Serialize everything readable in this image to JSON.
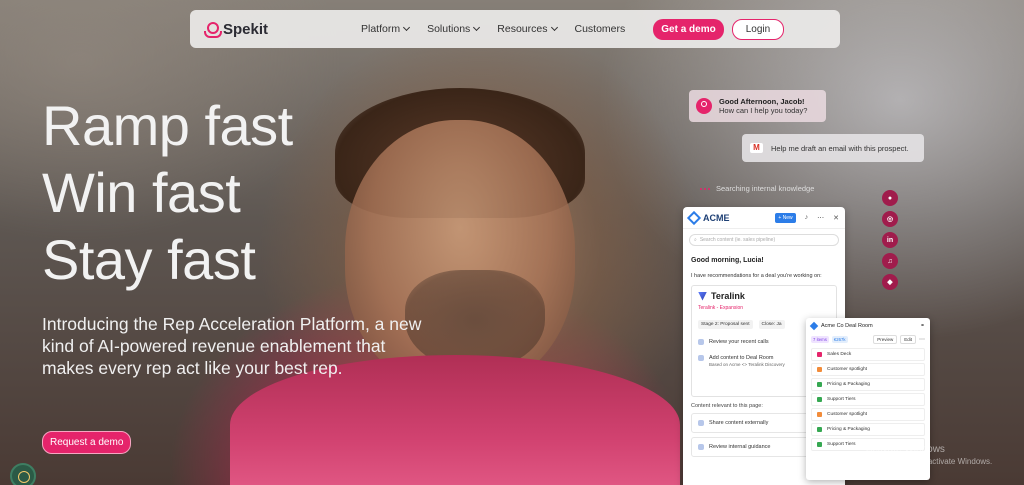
{
  "nav": {
    "brand": "Spekit",
    "menu": [
      {
        "label": "Platform"
      },
      {
        "label": "Solutions"
      },
      {
        "label": "Resources"
      },
      {
        "label": "Customers"
      }
    ],
    "demo_button": "Get a demo",
    "login_button": "Login"
  },
  "hero": {
    "line1": "Ramp fast",
    "line2": "Win fast",
    "line3": "Stay fast",
    "subtitle": "Introducing the Rep Acceleration Platform, a new kind of AI-powered revenue enablement that makes every rep act like your best rep.",
    "cta": "Request a demo"
  },
  "assistant": {
    "greeting_title": "Good Afternoon, Jacob!",
    "greeting_sub": "How can I help you today?",
    "prompt": "Help me draft an email with this prospect.",
    "status": "Searching internal knowledge"
  },
  "social": [
    "social-1",
    "social-2",
    "linkedin",
    "social-4",
    "social-5"
  ],
  "panel": {
    "brand": "ACME",
    "new_button": "+ New",
    "search_placeholder": "Search content (ie. sales pipeline)",
    "greeting": "Good morning, Lucia!",
    "intro": "I have recommendations for a deal you're working on:",
    "deal": {
      "name": "Teralink",
      "subtitle": "Teralink - Expansion",
      "stage": "Stage 2: Proposal sent",
      "close": "Close: Ja",
      "action1": "Review your recent calls",
      "action2": "Add content to Deal Room",
      "action2_sub": "Based on Acme <> Teralink Discovery"
    },
    "relevant_title": "Content relevant to this page:",
    "relevant": [
      "Share content externally",
      "Review internal guidance"
    ]
  },
  "deal_room": {
    "title": "Acme Co Deal Room",
    "tag1": "7 items",
    "tag2": "€267k",
    "preview": "Preview",
    "edit": "Edit",
    "items": [
      {
        "label": "Sales Deck",
        "color": "#e5246b"
      },
      {
        "label": "Customer spotlight",
        "color": "#f28c3a"
      },
      {
        "label": "Pricing & Packaging",
        "color": "#36a852"
      },
      {
        "label": "Support Tiers",
        "color": "#36a852"
      },
      {
        "label": "Customer spotlight",
        "color": "#f28c3a"
      },
      {
        "label": "Pricing & Packaging",
        "color": "#36a852"
      },
      {
        "label": "Support Tiers",
        "color": "#36a852"
      }
    ]
  },
  "watermark": {
    "title": "Activate Windows",
    "sub": "Go to Settings to activate Windows."
  },
  "colors": {
    "accent": "#e5246b",
    "blue": "#2c7de8"
  }
}
